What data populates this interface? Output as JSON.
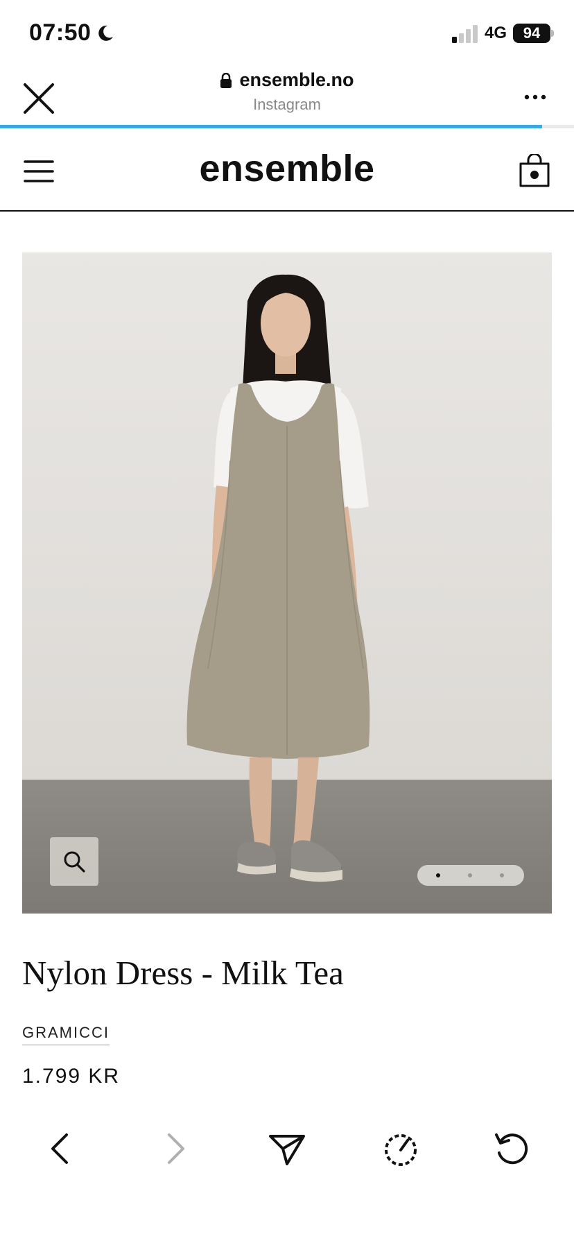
{
  "status_bar": {
    "time": "07:50",
    "network": "4G",
    "battery": "94",
    "icons": [
      "moon-icon",
      "signal-icon",
      "battery-icon"
    ]
  },
  "browser_header": {
    "url": "ensemble.no",
    "source": "Instagram",
    "load_progress": 0.945,
    "icons": [
      "close-icon",
      "lock-icon",
      "more-icon"
    ],
    "accent_color": "#3aa8e3"
  },
  "site_header": {
    "logo": "ensemble",
    "icons": [
      "menu-icon",
      "shopping-bag-icon"
    ]
  },
  "product": {
    "title": "Nylon Dress - Milk Tea",
    "brand": "GRAMICCI",
    "price": "1.799 KR",
    "image": {
      "total_images": 3,
      "active_index": 0,
      "icons": [
        "zoom-icon"
      ]
    }
  },
  "toolbar": {
    "icons": [
      "back-icon",
      "forward-icon",
      "share-icon",
      "speed-icon",
      "reload-icon"
    ],
    "forward_disabled": true
  }
}
